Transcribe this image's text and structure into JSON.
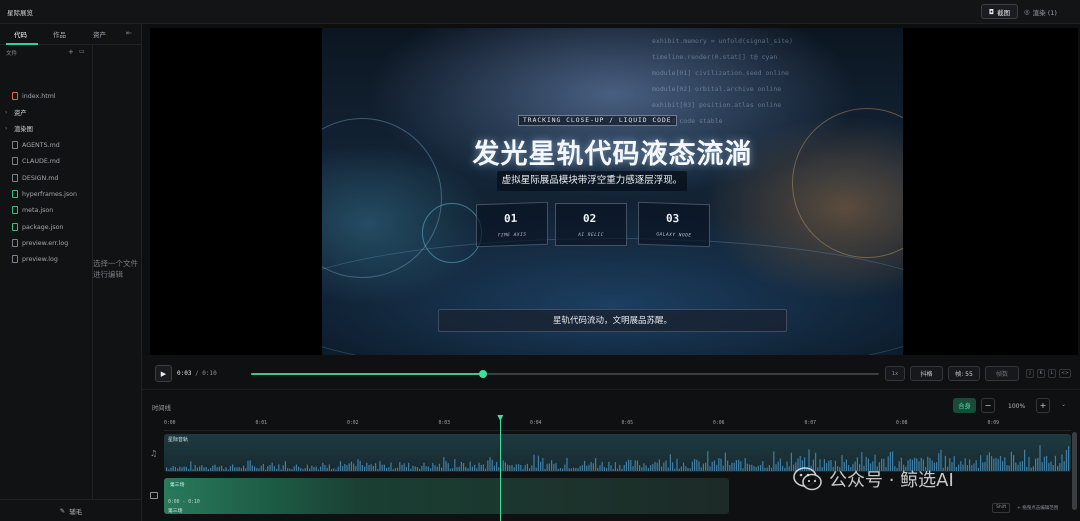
{
  "app": {
    "title": "星际展览"
  },
  "topbar": {
    "screenshot_label": "截图",
    "render_label": "渲染 (1)"
  },
  "sidebar": {
    "tabs": [
      {
        "label": "代码"
      },
      {
        "label": "作品"
      },
      {
        "label": "资产"
      }
    ],
    "files_header": "文件",
    "items": [
      {
        "label": "index.html",
        "type": "file",
        "color": "orange"
      },
      {
        "label": "资产",
        "type": "folder"
      },
      {
        "label": "渲染图",
        "type": "folder"
      },
      {
        "label": "AGENTS.md",
        "type": "file",
        "color": "gray"
      },
      {
        "label": "CLAUDE.md",
        "type": "file",
        "color": "gray"
      },
      {
        "label": "DESIGN.md",
        "type": "file",
        "color": "gray"
      },
      {
        "label": "hyperframes.json",
        "type": "file",
        "color": "green"
      },
      {
        "label": "meta.json",
        "type": "file",
        "color": "green"
      },
      {
        "label": "package.json",
        "type": "file",
        "color": "green"
      },
      {
        "label": "preview.err.log",
        "type": "file",
        "color": "gray"
      },
      {
        "label": "preview.log",
        "type": "file",
        "color": "gray"
      }
    ],
    "editor_placeholder": "选择一个文件进行编辑",
    "assist_label": "辅毛"
  },
  "preview": {
    "tracking_label": "TRACKING CLOSE-UP / LIQUID CODE",
    "headline": "发光星轨代码液态流淌",
    "subline": "虚拟星际展品模块带浮空重力感逐层浮现。",
    "cards": [
      {
        "num": "01",
        "label": "TIME AXIS"
      },
      {
        "num": "02",
        "label": "AI RELIC"
      },
      {
        "num": "03",
        "label": "GALAXY NODE"
      }
    ],
    "caption": "星轨代码流动，文明展品苏醒。",
    "code_lines": [
      "exhibit.memory = unfold(signal_site)",
      "timeline.render(0.stat[] t@ cyan",
      "module[01] civilization.seed online",
      "module[02] orbital.archive online",
      "exhibit[03] position.atlas online",
      "liquid code stable"
    ]
  },
  "transport": {
    "current_time": "0:03",
    "total_time": "0:10",
    "progress": 0.37,
    "speed_label": "1x",
    "trim_label": "抖格",
    "frame_label": "帧: 55",
    "frame_placeholder": "帧数",
    "shortcut_keys": [
      "J",
      "K",
      "L",
      "<>"
    ]
  },
  "timeline": {
    "label": "时间线",
    "fit_label": "合身",
    "zoom_level": "100%",
    "ruler_ticks": [
      "0:00",
      "0:01",
      "0:02",
      "0:03",
      "0:04",
      "0:05",
      "0:06",
      "0:07",
      "0:08",
      "0:09"
    ],
    "playhead_seconds": 3.67,
    "audio_track_title": "星际音轨",
    "scene_chip": "第三场",
    "scene_range": "0:00 - 0:10",
    "scene_name": "第三场",
    "hint_kbd": "Shift",
    "hint_text": "+ 拖曳点击编辑范围"
  },
  "watermark": {
    "text": "公众号 · 鲸选AI"
  }
}
